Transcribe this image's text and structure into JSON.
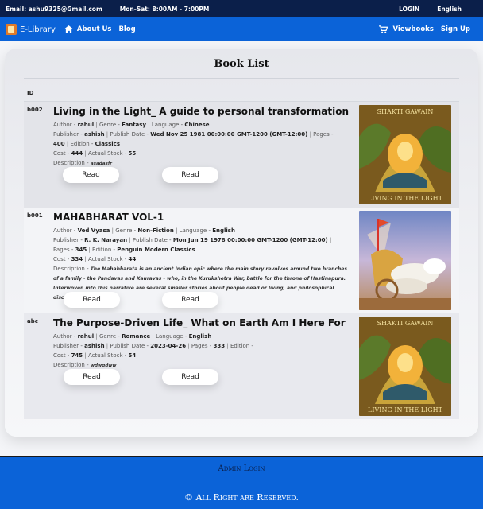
{
  "topbar": {
    "email": "Email: ashu9325@Gmail.com",
    "hours": "Mon-Sat: 8:00AM - 7:00PM",
    "login": "LOGIN",
    "language": "English"
  },
  "navbar": {
    "brand": "E-Library",
    "about": "About Us",
    "blog": "Blog",
    "viewbooks": "Viewbooks",
    "signup": "Sign Up"
  },
  "main": {
    "title": "Book List",
    "id_header": "ID",
    "read_label": "Read",
    "books": [
      {
        "id": "b002",
        "title": "Living in the Light_ A guide to personal transformation",
        "author": "rahul",
        "genre": "Fantasy",
        "language": "Chinese",
        "publisher": "ashish",
        "publish_date": "Wed Nov 25 1981 00:00:00 GMT-1200 (GMT-12:00)",
        "pages": "400",
        "edition": "Classics",
        "cost": "444",
        "actual_stock": "55",
        "description": "asadasfr",
        "cover": "Shakti Gawain - Living in the Light"
      },
      {
        "id": "b001",
        "title": "MAHABHARAT VOL-1",
        "author": "Ved Vyasa",
        "genre": "Non-Fiction",
        "language": "English",
        "publisher": "R. K. Narayan",
        "publish_date": "Mon Jun 19 1978 00:00:00 GMT-1200 (GMT-12:00)",
        "pages": "345",
        "edition": "Penguin Modern Classics",
        "cost": "334",
        "actual_stock": "44",
        "description": "The Mahabharata is an ancient Indian epic where the main story revolves around two branches of a family - the Pandavas and Kauravas - who, in the Kurukshetra War, battle for the throne of Hastinapura. Interwoven into this narrative are several smaller stories about people dead or living, and philosophical discourses.",
        "cover": "Chariot with white horses"
      },
      {
        "id": "abc",
        "title": "The Purpose-Driven Life_ What on Earth Am I Here For",
        "author": "rahul",
        "genre": "Romance",
        "language": "English",
        "publisher": "ashish",
        "publish_date": "2023-04-26",
        "pages": "333",
        "edition": "",
        "cost": "745",
        "actual_stock": "54",
        "description": "wdwqdww",
        "cover": "Shakti Gawain - Living in the Light"
      }
    ]
  },
  "labels": {
    "author": "Author -",
    "genre": "Genre -",
    "language": "Language -",
    "publisher": "Publisher -",
    "publish_date": "Publish Date -",
    "pages": "Pages -",
    "edition": "Edition -",
    "cost": "Cost -",
    "actual_stock": "Actual Stock -",
    "description": "Description -"
  },
  "footer": {
    "admin_login": "Admin Login",
    "copyright": "© All Right are Reserved."
  },
  "cover_text": {
    "author": "SHAKTI GAWAIN",
    "title": "LIVING IN THE LIGHT"
  },
  "colors": {
    "topbar": "#0b1f4a",
    "navbar": "#0b63d8",
    "footer": "#0b63d8"
  }
}
